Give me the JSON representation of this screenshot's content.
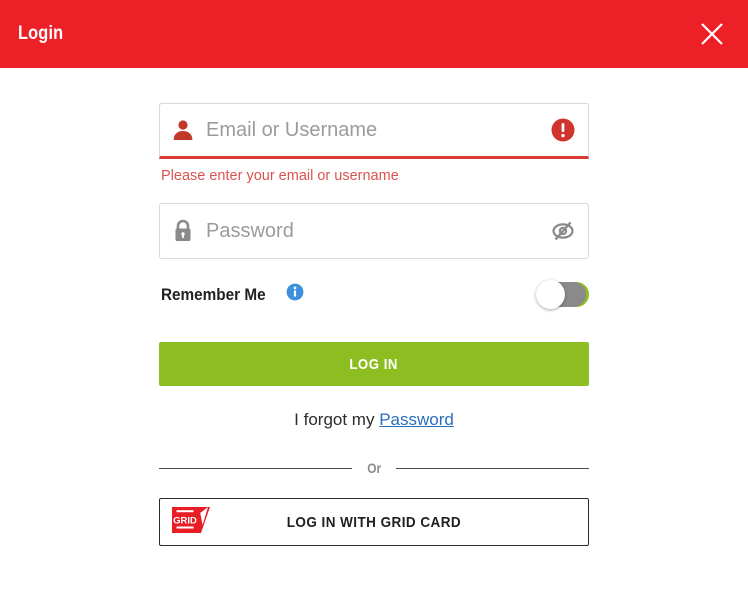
{
  "header": {
    "title": "Login",
    "close_icon": "close-icon",
    "background_color": "#ED2027",
    "text_color": "#FFFFFF"
  },
  "form": {
    "email_field": {
      "placeholder": "Email or Username",
      "value": "",
      "leading_icon": "user-icon",
      "trailing_icon": "error-exclamation-icon",
      "state": "error",
      "error_color": "#D83B34"
    },
    "email_error_message": "Please enter your email or username",
    "password_field": {
      "placeholder": "Password",
      "value": "",
      "leading_icon": "lock-icon",
      "trailing_icon": "eye-slash-icon",
      "state": "normal"
    },
    "remember_me": {
      "label": "Remember Me",
      "info_icon": "info-icon",
      "toggle_state": "off",
      "toggle_on_color": "#8CBE22",
      "toggle_off_color": "#8A8A8A"
    },
    "login_button": {
      "label": "LOG IN",
      "color": "#8CBE22"
    },
    "forgot": {
      "prefix": "I forgot my ",
      "link_label": "Password",
      "link_color": "#2A6EBB"
    },
    "divider": {
      "label": "Or"
    },
    "grid_card_button": {
      "label": "LOG IN WITH GRID CARD",
      "logo_icon": "grid-card-logo-icon",
      "logo_text": "GRID",
      "logo_color": "#E81E26"
    }
  }
}
